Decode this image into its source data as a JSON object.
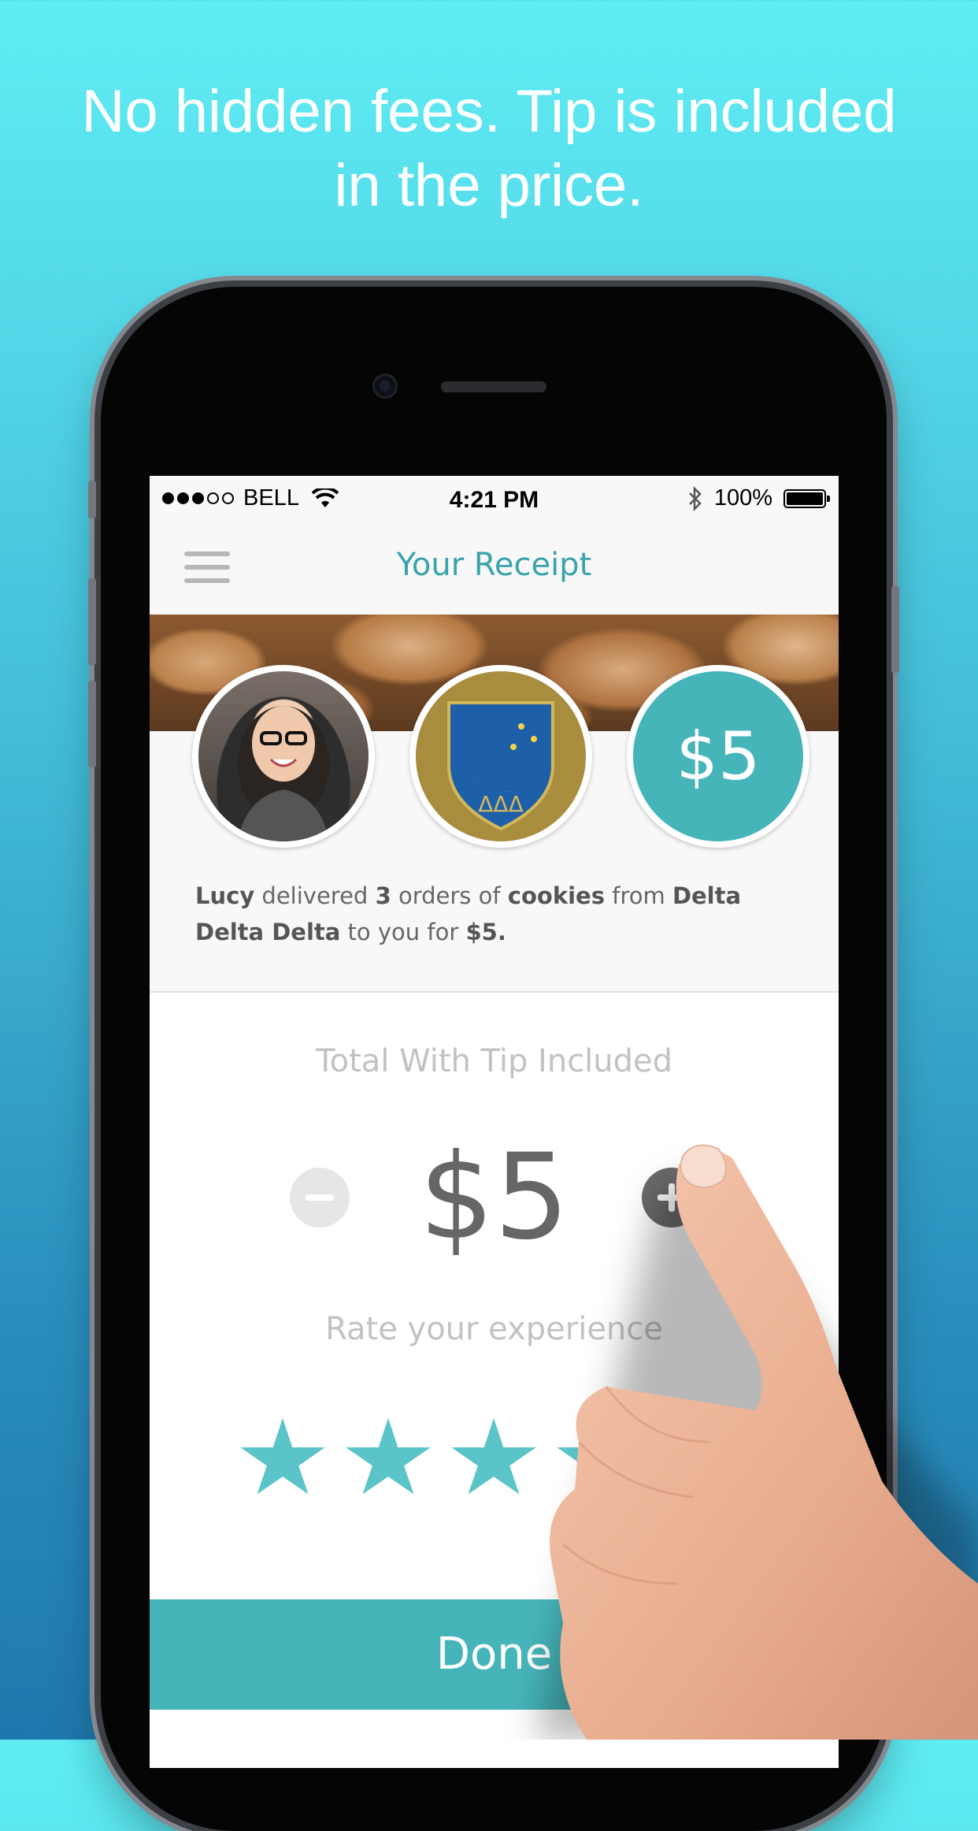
{
  "headline": {
    "line1": "No hidden fees. Tip is included",
    "line2": "in the price."
  },
  "status_bar": {
    "carrier": "BELL",
    "time": "4:21 PM",
    "battery": "100%",
    "signal_bars_filled": 3,
    "signal_bars_total": 5
  },
  "nav": {
    "title": "Your Receipt"
  },
  "receipt": {
    "price_badge": "$5",
    "crest_letters": "ΔΔΔ",
    "summary": {
      "courier": "Lucy",
      "delivered": " delivered ",
      "count": "3",
      "orders_of": " orders of ",
      "item": "cookies",
      "from": " from ",
      "org": "Delta Delta Delta",
      "to_you_for": " to you for ",
      "amount": "$5.",
      "end": ""
    }
  },
  "total": {
    "label": "Total With Tip Included",
    "amount": "$5"
  },
  "rating": {
    "label": "Rate your experience",
    "stars_total": 5,
    "stars_selected": 5
  },
  "done_button": {
    "label": "Done"
  },
  "colors": {
    "accent": "#46b5ba",
    "title": "#3aa3ab",
    "star": "#5ac4c8"
  }
}
